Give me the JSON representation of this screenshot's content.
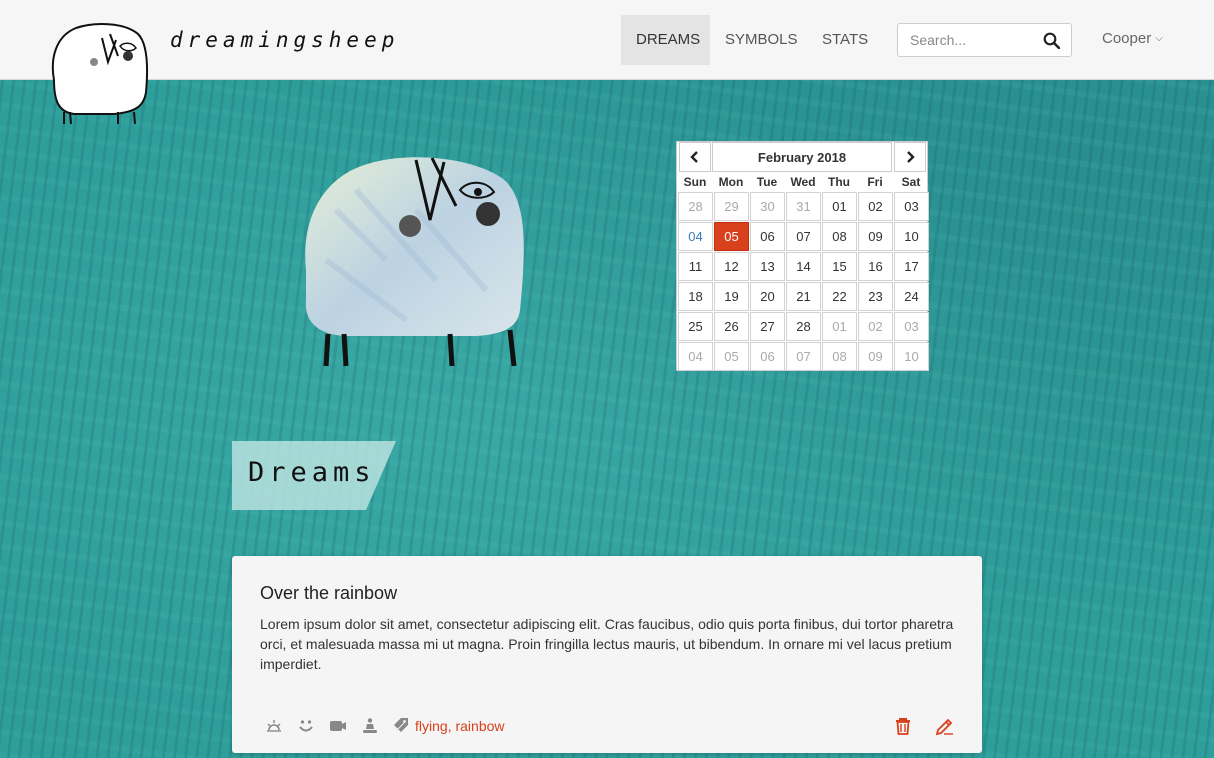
{
  "brand": {
    "name": "dreamingsheep",
    "logo_icon": "sheep-logo-icon"
  },
  "nav": {
    "items": [
      {
        "label": "DREAMS",
        "active": true
      },
      {
        "label": "SYMBOLS",
        "active": false
      },
      {
        "label": "STATS",
        "active": false
      }
    ]
  },
  "search": {
    "placeholder": "Search...",
    "value": "",
    "icon": "search-icon"
  },
  "user": {
    "name": "Cooper",
    "chevron": "chevron-down-icon"
  },
  "calendar": {
    "title": "February 2018",
    "prev_icon": "chevron-left-icon",
    "next_icon": "chevron-right-icon",
    "weekdays": [
      "Sun",
      "Mon",
      "Tue",
      "Wed",
      "Thu",
      "Fri",
      "Sat"
    ],
    "weeks": [
      [
        "28",
        "29",
        "30",
        "31",
        "01",
        "02",
        "03"
      ],
      [
        "04",
        "05",
        "06",
        "07",
        "08",
        "09",
        "10"
      ],
      [
        "11",
        "12",
        "13",
        "14",
        "15",
        "16",
        "17"
      ],
      [
        "18",
        "19",
        "20",
        "21",
        "22",
        "23",
        "24"
      ],
      [
        "25",
        "26",
        "27",
        "28",
        "01",
        "02",
        "03"
      ],
      [
        "04",
        "05",
        "06",
        "07",
        "08",
        "09",
        "10"
      ]
    ],
    "selected": "05",
    "accent_color": "#d9401c"
  },
  "section": {
    "heading": "Dreams"
  },
  "dream": {
    "title": "Over the rainbow",
    "body": "Lorem ipsum dolor sit amet, consectetur adipiscing elit. Cras faucibus, odio quis porta finibus, dui tortor pharetra orci, et malesuada massa mi ut magna. Proin fringilla lectus mauris, ut bibendum. In ornare mi vel lacus pretium imperdiet.",
    "icons": [
      "sunrise-icon",
      "smile-icon",
      "camera-icon",
      "meditation-icon",
      "tag-icon"
    ],
    "tags": [
      "flying",
      "rainbow"
    ],
    "tag_separator": ", ",
    "actions": [
      "trash-icon",
      "edit-icon"
    ]
  }
}
